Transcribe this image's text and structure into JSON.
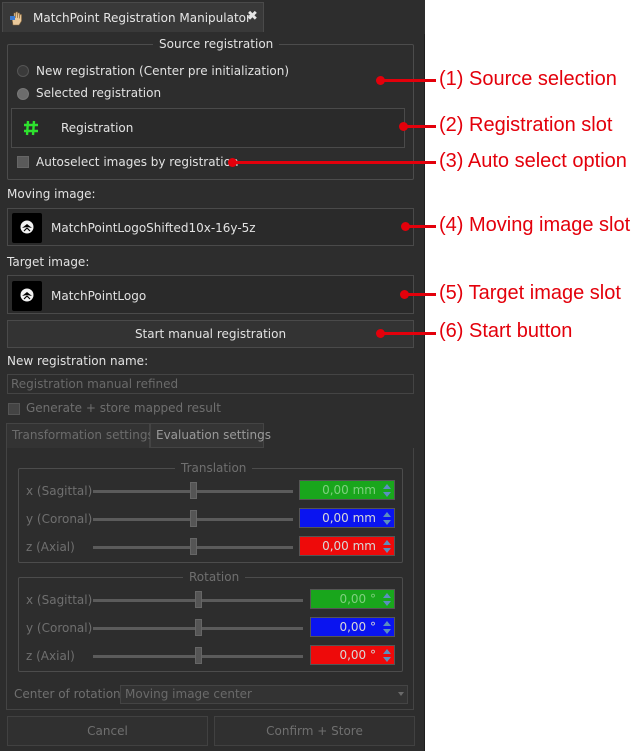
{
  "window": {
    "title": "MatchPoint Registration Manipulator",
    "close_glyph": "✖"
  },
  "source_registration": {
    "title": "Source registration",
    "option_new": "New registration (Center pre initialization)",
    "option_selected": "Selected registration",
    "registration_slot": "Registration",
    "autoselect_label": "Autoselect images by registration"
  },
  "moving_image": {
    "label": "Moving image:",
    "name": "MatchPointLogoShifted10x-16y-5z"
  },
  "target_image": {
    "label": "Target image:",
    "name": "MatchPointLogo"
  },
  "start_button": "Start manual registration",
  "new_registration": {
    "label": "New registration name:",
    "value": "Registration manual refined",
    "generate_label": "Generate + store mapped result"
  },
  "tabs": [
    "Transformation settings",
    "Evaluation settings"
  ],
  "translation": {
    "title": "Translation",
    "rows": [
      {
        "label": "x (Sagittal)",
        "value": "0,00 mm",
        "level": 0.5
      },
      {
        "label": "y (Coronal)",
        "value": "0,00 mm",
        "level": 0.5
      },
      {
        "label": "z (Axial)",
        "value": "0,00 mm",
        "level": 0.5
      }
    ]
  },
  "rotation": {
    "title": "Rotation",
    "rows": [
      {
        "label": "x (Sagittal)",
        "value": "0,00 °",
        "level": 0.5
      },
      {
        "label": "y (Coronal)",
        "value": "0,00 °",
        "level": 0.5
      },
      {
        "label": "z (Axial)",
        "value": "0,00 °",
        "level": 0.5
      }
    ]
  },
  "center_of_rotation": {
    "label": "Center of rotation:",
    "value": "Moving image center"
  },
  "buttons": {
    "cancel": "Cancel",
    "confirm": "Confirm + Store"
  },
  "annotations": [
    "(1) Source selection",
    "(2) Registration slot",
    "(3) Auto select option",
    "(4) Moving image slot",
    "(5) Target image slot",
    "(6) Start button"
  ],
  "colors": {
    "annotation": "#e3000b",
    "x_axis": "#19a61c",
    "y_axis": "#0a14f0",
    "z_axis": "#ee0a0a",
    "registration_icon": "#2ee22e"
  }
}
